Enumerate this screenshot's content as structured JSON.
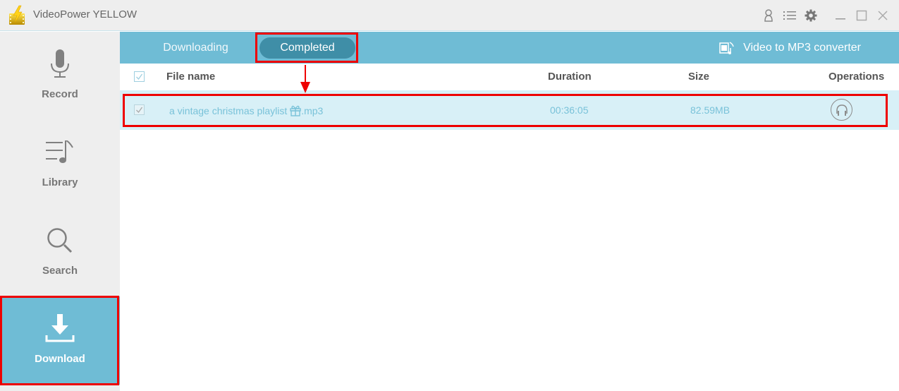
{
  "window": {
    "title": "VideoPower YELLOW",
    "controls": [
      "user-icon",
      "menu-list-icon",
      "settings-gear-icon",
      "minimize-icon",
      "maximize-icon",
      "close-icon"
    ]
  },
  "sidebar": {
    "items": [
      {
        "label": "Record",
        "icon": "microphone-icon",
        "active": false
      },
      {
        "label": "Library",
        "icon": "music-list-icon",
        "active": false
      },
      {
        "label": "Search",
        "icon": "search-icon",
        "active": false
      },
      {
        "label": "Download",
        "icon": "download-icon",
        "active": true
      }
    ]
  },
  "tabs": {
    "items": [
      {
        "label": "Downloading",
        "active": false
      },
      {
        "label": "Completed",
        "active": true
      }
    ],
    "converter_label": "Video to MP3 converter"
  },
  "table": {
    "columns": [
      "File name",
      "Duration",
      "Size",
      "Operations"
    ],
    "rows": [
      {
        "checked": true,
        "file_name_prefix": "a vintage christmas playlist ",
        "file_name_icon": "gift-icon",
        "file_name_suffix": ".mp3",
        "duration": "00:36:05",
        "size": "82.59MB",
        "operation": "play-headphones-icon"
      }
    ]
  },
  "colors": {
    "accent": "#6fbcd5",
    "active_tab": "#3f8ea7",
    "row_highlight": "#d8f0f7",
    "row_text": "#79c2d9",
    "annotation": "#ee0000"
  }
}
